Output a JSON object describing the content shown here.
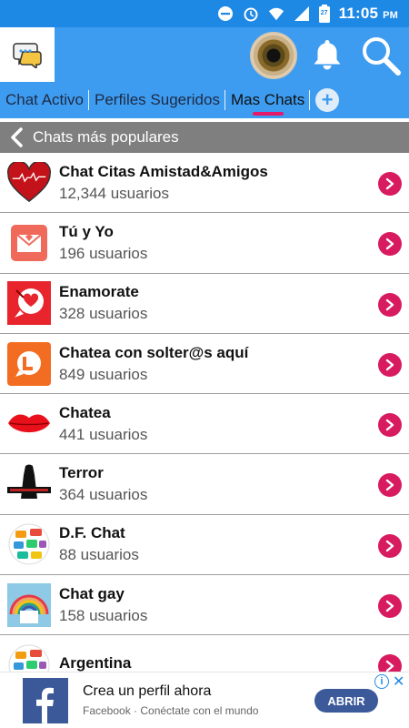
{
  "statusbar": {
    "time": "11:05",
    "ampm": "PM",
    "battery": "27"
  },
  "tabs": [
    {
      "label": "Chat Activo"
    },
    {
      "label": "Perfiles Sugeridos"
    },
    {
      "label": "Mas Chats"
    }
  ],
  "section": {
    "title": "Chats más populares"
  },
  "chats": [
    {
      "name": "Chat Citas Amistad&Amigos",
      "count": "12,344 usuarios",
      "icon": "red-heart-icon"
    },
    {
      "name": "Tú y Yo",
      "count": "196 usuarios",
      "icon": "envelope-icon"
    },
    {
      "name": "Enamorate",
      "count": "328 usuarios",
      "icon": "love-chat-icon"
    },
    {
      "name": "Chatea con solter@s aquí",
      "count": "849 usuarios",
      "icon": "l-chat-icon"
    },
    {
      "name": "Chatea",
      "count": "441 usuarios",
      "icon": "lips-icon"
    },
    {
      "name": "Terror",
      "count": "364 usuarios",
      "icon": "terror-figure-icon"
    },
    {
      "name": "D.F. Chat",
      "count": "88 usuarios",
      "icon": "chat-bubbles-icon"
    },
    {
      "name": "Chat gay",
      "count": "158 usuarios",
      "icon": "rainbow-icon"
    },
    {
      "name": "Argentina",
      "count": "",
      "icon": "chat-bubbles-icon"
    }
  ],
  "ad": {
    "title": "Crea un perfil ahora",
    "subtitle": "Facebook · Conéctate con el mundo",
    "cta": "ABRIR",
    "info": "i",
    "close": "✕"
  }
}
